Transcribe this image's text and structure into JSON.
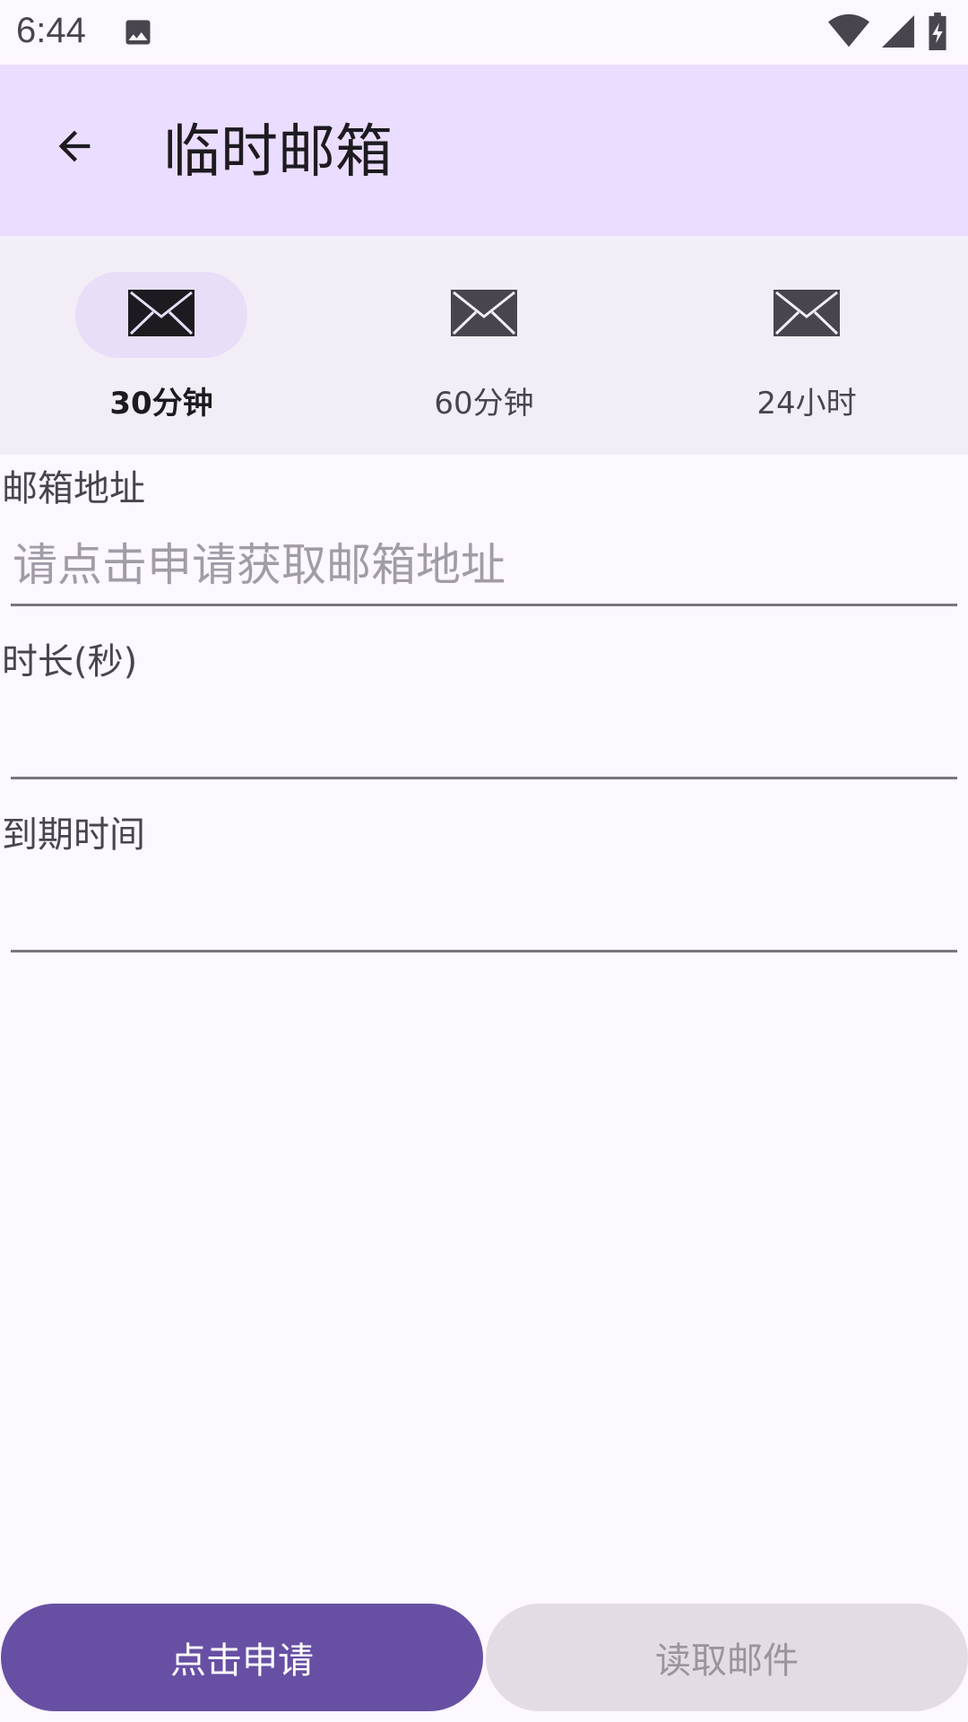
{
  "status_bar": {
    "time": "6:44",
    "icons": [
      "image-icon",
      "wifi-icon",
      "signal-icon",
      "battery-icon"
    ]
  },
  "top_bar": {
    "title": "临时邮箱",
    "back_icon": "arrow-back-icon"
  },
  "tabs": [
    {
      "label": "30分钟",
      "icon": "mail-icon",
      "selected": true
    },
    {
      "label": "60分钟",
      "icon": "mail-icon",
      "selected": false
    },
    {
      "label": "24小时",
      "icon": "mail-icon",
      "selected": false
    }
  ],
  "fields": {
    "email": {
      "label": "邮箱地址",
      "value": "",
      "placeholder": "请点击申请获取邮箱地址"
    },
    "duration": {
      "label": "时长(秒)",
      "value": "",
      "placeholder": ""
    },
    "expiry": {
      "label": "到期时间",
      "value": "",
      "placeholder": ""
    }
  },
  "buttons": {
    "apply": "点击申请",
    "read": "读取邮件"
  },
  "colors": {
    "background": "#fdf7ff",
    "top_bar": "#eaddff",
    "tab_bar": "#f3edf7",
    "primary": "#6750a4",
    "disabled_button": "#e3dce5"
  }
}
